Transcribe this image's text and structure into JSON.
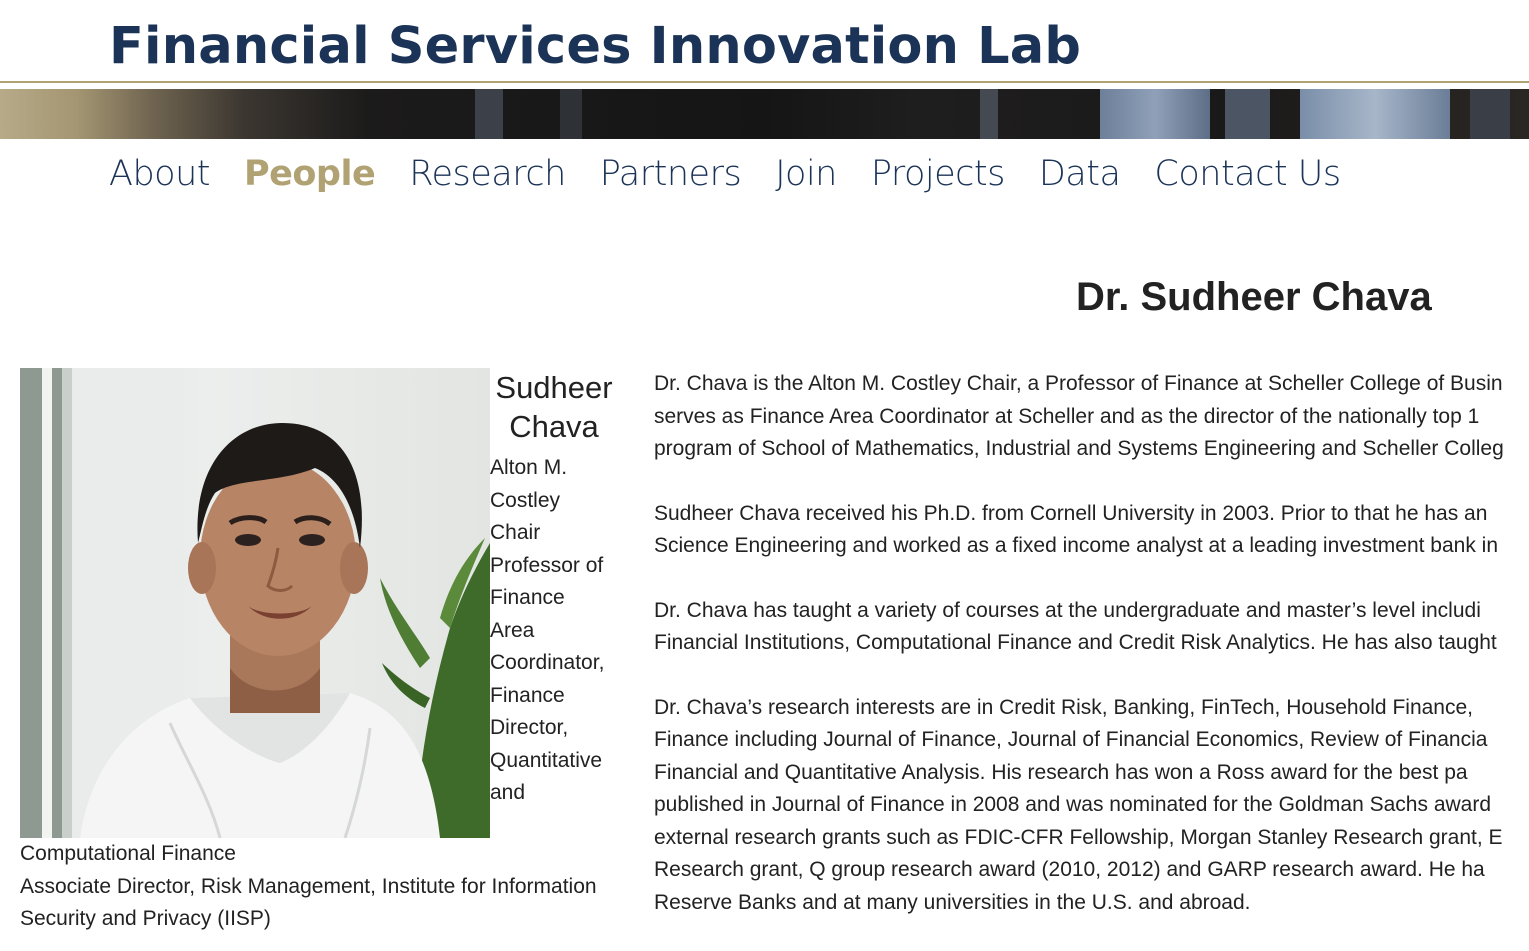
{
  "site": {
    "title": "Financial Services Innovation Lab"
  },
  "nav": {
    "items": [
      {
        "label": "About",
        "active": false
      },
      {
        "label": "People",
        "active": true
      },
      {
        "label": "Research",
        "active": false
      },
      {
        "label": "Partners",
        "active": false
      },
      {
        "label": "Join",
        "active": false
      },
      {
        "label": "Projects",
        "active": false
      },
      {
        "label": "Data",
        "active": false
      },
      {
        "label": "Contact Us",
        "active": false
      }
    ]
  },
  "page": {
    "heading": "Dr. Sudheer Chava"
  },
  "profile": {
    "name_line1": "Sudheer",
    "name_line2": "Chava",
    "title_part1": "Alton M. Costley Chair Professor of Finance Area Coordinator, Finance Director, Quantitative and",
    "title_part2": "Computational Finance",
    "title_part3": "Associate Director, Risk Management, Institute for Information Security and Privacy (IISP)"
  },
  "bio": {
    "p1": [
      "Dr. Chava is the Alton M. Costley Chair, a Professor of Finance at Scheller College of Busin",
      "serves as Finance Area Coordinator at Scheller and as the director of the nationally top 1",
      "program of School of Mathematics, Industrial and Systems Engineering and Scheller Colleg"
    ],
    "p2": [
      "Sudheer Chava received his Ph.D. from Cornell University in 2003. Prior to that he has an",
      "Science Engineering and worked as a fixed income analyst at a leading investment bank in"
    ],
    "p3": [
      "Dr. Chava has taught a variety of courses at the undergraduate and master’s level includi",
      "Financial Institutions, Computational Finance and Credit Risk Analytics. He has also taught"
    ],
    "p4": [
      "Dr. Chava’s research interests are in Credit Risk, Banking, FinTech, Household Finance,",
      "Finance including Journal of Finance, Journal of Financial Economics, Review of Financia",
      "Financial and Quantitative Analysis. His research has won a Ross award for the best pa",
      "published in Journal of Finance in 2008 and was nominated for the Goldman Sachs award",
      "external research grants such as FDIC-CFR Fellowship, Morgan Stanley Research grant, E",
      "Research grant, Q group research award (2010, 2012) and GARP research award. He ha",
      "Reserve Banks and at many universities in the U.S. and abroad."
    ]
  },
  "colors": {
    "navy": "#1b3357",
    "gold": "#b1a274",
    "text": "#222222"
  }
}
